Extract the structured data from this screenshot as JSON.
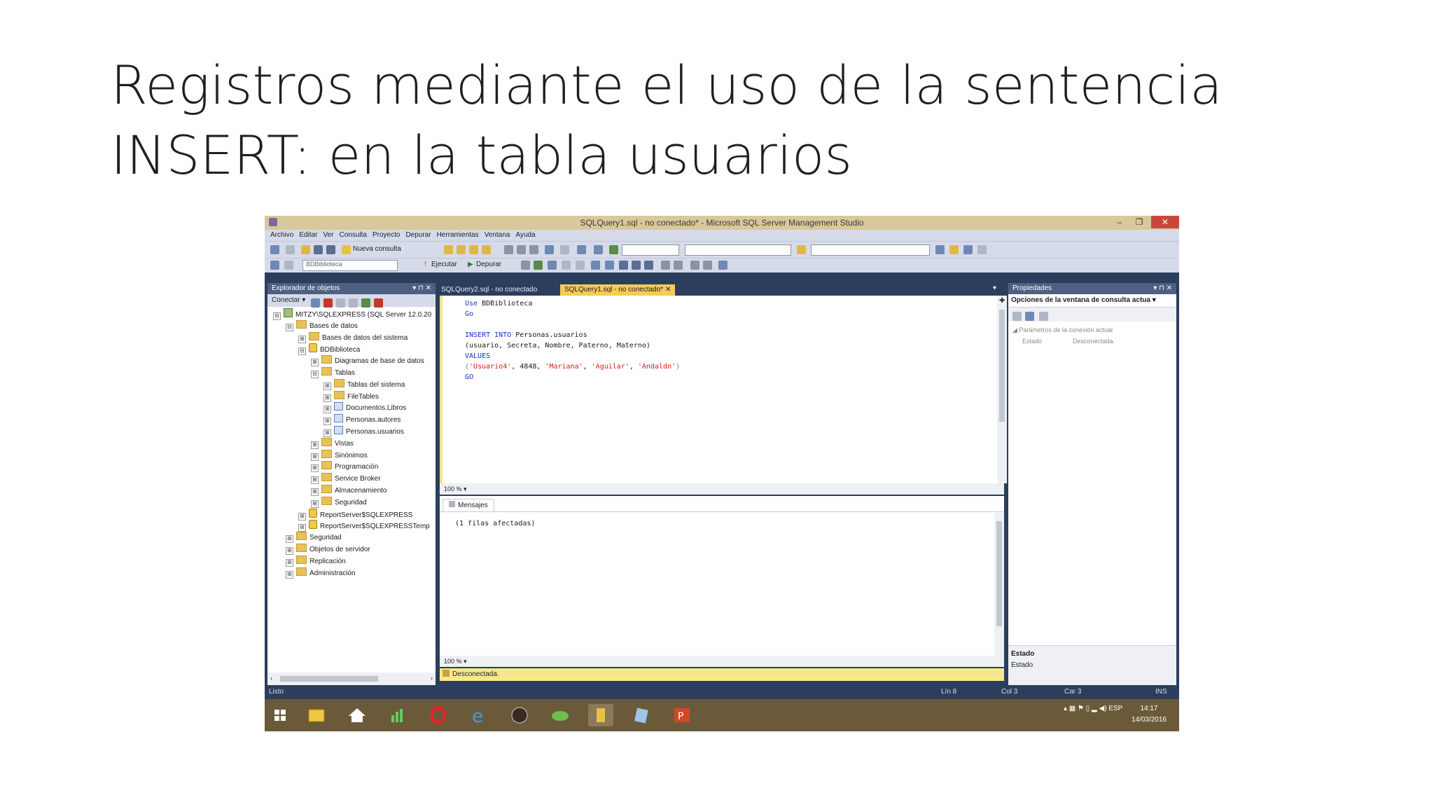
{
  "slide": {
    "title_line1": "Registros mediante el uso de la sentencia",
    "title_line2": "INSERT: en la tabla usuarios"
  },
  "window": {
    "title": "SQLQuery1.sql - no conectado* - Microsoft SQL Server Management Studio",
    "minimize": "–",
    "restore": "❐",
    "close": "✕"
  },
  "menu": [
    "Archivo",
    "Editar",
    "Ver",
    "Consulta",
    "Proyecto",
    "Depurar",
    "Herramientas",
    "Ventana",
    "Ayuda"
  ],
  "toolbar": {
    "new_query": "Nueva consulta",
    "database": "BDBiblioteca",
    "execute": "Ejecutar",
    "debug": "Depurar"
  },
  "explorer": {
    "header": "Explorador de objetos",
    "header_controls": "▾ ⊓ ✕",
    "connect": "Conectar",
    "nodes": [
      {
        "label": "MITZY\\SQLEXPRESS (SQL Server 12.0.20",
        "icon": "srv",
        "exp": "⊟",
        "level": 0
      },
      {
        "label": "Bases de datos",
        "icon": "fold",
        "exp": "⊟",
        "level": 1
      },
      {
        "label": "Bases de datos del sistema",
        "icon": "fold",
        "exp": "⊞",
        "level": 2
      },
      {
        "label": "BDBiblioteca",
        "icon": "db",
        "exp": "⊟",
        "level": 2
      },
      {
        "label": "Diagramas de base de datos",
        "icon": "fold",
        "exp": "⊞",
        "level": 3
      },
      {
        "label": "Tablas",
        "icon": "fold",
        "exp": "⊟",
        "level": 3
      },
      {
        "label": "Tablas del sistema",
        "icon": "fold",
        "exp": "⊞",
        "level": 4
      },
      {
        "label": "FileTables",
        "icon": "fold",
        "exp": "⊞",
        "level": 4
      },
      {
        "label": "Documentos.Libros",
        "icon": "tbl",
        "exp": "⊞",
        "level": 4
      },
      {
        "label": "Personas.autores",
        "icon": "tbl",
        "exp": "⊞",
        "level": 4
      },
      {
        "label": "Personas.usuarios",
        "icon": "tbl",
        "exp": "⊞",
        "level": 4
      },
      {
        "label": "Vistas",
        "icon": "fold",
        "exp": "⊞",
        "level": 3
      },
      {
        "label": "Sinónimos",
        "icon": "fold",
        "exp": "⊞",
        "level": 3
      },
      {
        "label": "Programación",
        "icon": "fold",
        "exp": "⊞",
        "level": 3
      },
      {
        "label": "Service Broker",
        "icon": "fold",
        "exp": "⊞",
        "level": 3
      },
      {
        "label": "Almacenamiento",
        "icon": "fold",
        "exp": "⊞",
        "level": 3
      },
      {
        "label": "Seguridad",
        "icon": "fold",
        "exp": "⊞",
        "level": 3
      },
      {
        "label": "ReportServer$SQLEXPRESS",
        "icon": "db",
        "exp": "⊞",
        "level": 2
      },
      {
        "label": "ReportServer$SQLEXPRESSTemp",
        "icon": "db",
        "exp": "⊞",
        "level": 2
      },
      {
        "label": "Seguridad",
        "icon": "fold",
        "exp": "⊞",
        "level": 1
      },
      {
        "label": "Objetos de servidor",
        "icon": "fold",
        "exp": "⊞",
        "level": 1
      },
      {
        "label": "Replicación",
        "icon": "fold",
        "exp": "⊞",
        "level": 1
      },
      {
        "label": "Administración",
        "icon": "fold",
        "exp": "⊞",
        "level": 1
      }
    ]
  },
  "tabs": [
    {
      "label": "SQLQuery2.sql - no conectado",
      "active": false
    },
    {
      "label": "SQLQuery1.sql - no conectado*",
      "active": true
    }
  ],
  "editor": {
    "lines": [
      [
        {
          "t": "Use ",
          "c": "kw"
        },
        {
          "t": "BDBiblioteca",
          "c": "txt"
        }
      ],
      [
        {
          "t": "Go",
          "c": "kw"
        }
      ],
      [],
      [
        {
          "t": "INSERT INTO ",
          "c": "kw"
        },
        {
          "t": "Personas.usuarios",
          "c": "txt"
        }
      ],
      [
        {
          "t": "(usuario, Secreta, Nombre, Paterno, Materno)",
          "c": "txt"
        }
      ],
      [
        {
          "t": "VALUES",
          "c": "kw"
        }
      ],
      [
        {
          "t": "(",
          "c": "gray"
        },
        {
          "t": "'Usuario4'",
          "c": "str"
        },
        {
          "t": ", 4848, ",
          "c": "txt"
        },
        {
          "t": "'Mariana'",
          "c": "str"
        },
        {
          "t": ", ",
          "c": "txt"
        },
        {
          "t": "'Aguilar'",
          "c": "str"
        },
        {
          "t": ", ",
          "c": "txt"
        },
        {
          "t": "'Andaldn'",
          "c": "str"
        },
        {
          "t": ")",
          "c": "gray"
        }
      ],
      [
        {
          "t": "GO",
          "c": "kw"
        }
      ]
    ],
    "zoom": "100 %"
  },
  "results": {
    "tab": "Mensajes",
    "message": "(1 filas afectadas)",
    "zoom": "100 %"
  },
  "query_status": "Desconectada.",
  "properties": {
    "header": "Propiedades",
    "header_controls": "▾ ⊓ ✕",
    "combo": "Opciones de la ventana de consulta actua",
    "group": "Parámetros de la conexión actual",
    "row_name": "Estado",
    "row_value": "Desconectada.",
    "footer_title": "Estado",
    "footer_desc": "Estado"
  },
  "statusbar": {
    "ready": "Listo",
    "line": "Lín 8",
    "col": "Col 3",
    "car": "Car 3",
    "mode": "INS"
  },
  "taskbar": {
    "lang": "ESP",
    "time": "14:17",
    "date": "14/03/2016"
  },
  "colors": {
    "accent": "#f5cc56",
    "ide_frame": "#2c3e5d",
    "keyword": "#1a2ecc",
    "string": "#d42020"
  }
}
